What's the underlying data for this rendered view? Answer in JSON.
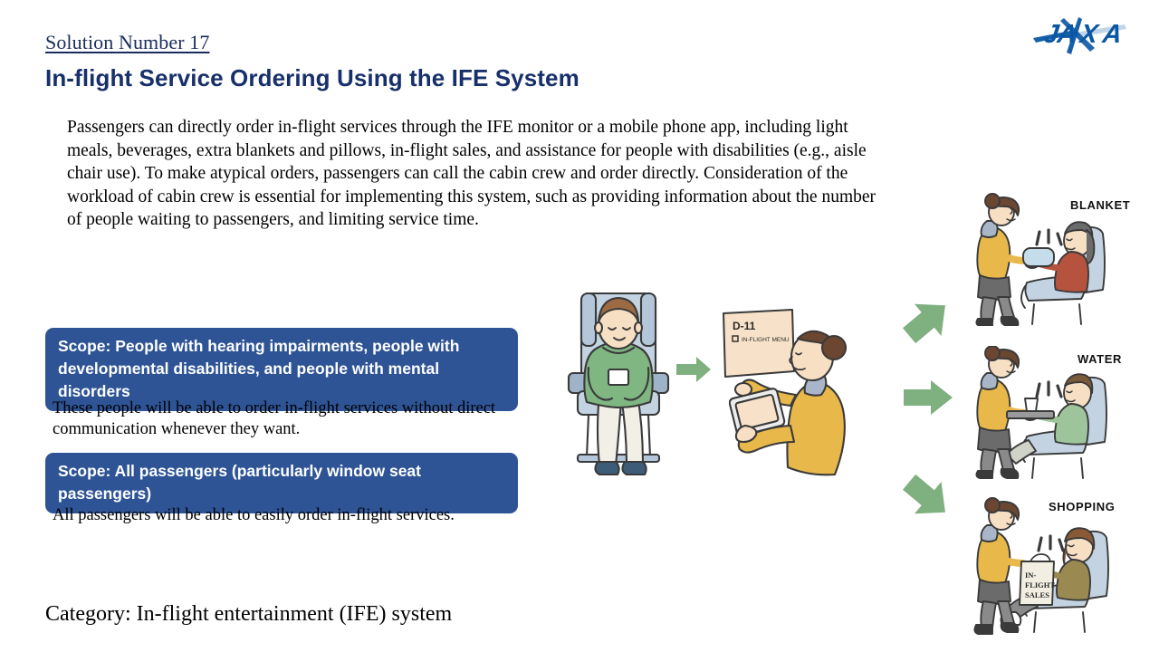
{
  "header": {
    "solution_number": "Solution Number 17",
    "title": "In-flight Service Ordering Using the IFE System",
    "logo_text": "JAXA"
  },
  "body": {
    "paragraph": "Passengers can directly order in-flight services through the IFE monitor or a mobile phone app, including light meals, beverages, extra blankets and pillows, in-flight sales, and assistance for people with disabilities (e.g., aisle chair use). To make atypical orders, passengers can call the cabin crew and order directly. Consideration of the workload of cabin crew is essential for implementing this system, such as providing information about the number of people waiting to passengers, and limiting service time."
  },
  "scopes": [
    {
      "banner": "Scope: People with hearing impairments, people with developmental disabilities, and people with mental disorders",
      "description": "These people will be able to order in-flight services without direct communication whenever they want."
    },
    {
      "banner": "Scope: All passengers (particularly window seat passengers)",
      "description": "All passengers will be able to easily order in-flight services."
    }
  ],
  "footer": {
    "category": "Category: In-flight entertainment (IFE) system"
  },
  "illustration": {
    "ife_screen": {
      "heading": "D-11",
      "subline": "IN-FLIGHT MENU"
    },
    "shopping_bag_text_1": "IN-",
    "shopping_bag_text_2": "FLIGHT",
    "shopping_bag_text_3": "SALES",
    "scenes": [
      {
        "label": "BLANKET"
      },
      {
        "label": "WATER"
      },
      {
        "label": "SHOPPING"
      }
    ]
  },
  "colors": {
    "banner_blue": "#2e5496",
    "title_navy": "#17306b",
    "arrow_green": "#7fb07f",
    "crew_uniform": "#e8b84b",
    "seat_blue": "#c3d3e2",
    "hoodie_green": "#7fb682",
    "screen_cream": "#f7e2c9"
  }
}
